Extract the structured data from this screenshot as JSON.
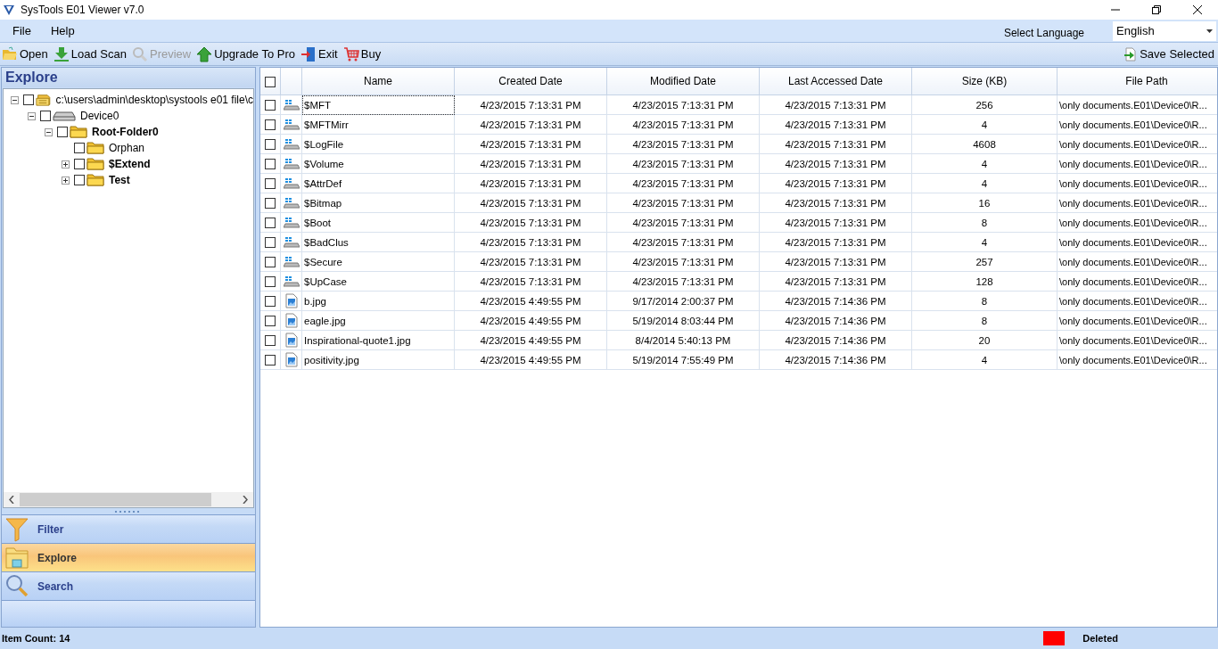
{
  "window": {
    "title": "SysTools E01 Viewer v7.0"
  },
  "menu": [
    "File",
    "Help"
  ],
  "language": {
    "label": "Select Language",
    "value": "English"
  },
  "toolbar": [
    {
      "kind": "open",
      "label": "Open",
      "disabled": false
    },
    {
      "kind": "load",
      "label": "Load Scan",
      "disabled": false
    },
    {
      "kind": "preview",
      "label": "Preview",
      "disabled": true
    },
    {
      "kind": "upgrade",
      "label": "Upgrade To Pro",
      "disabled": false
    },
    {
      "kind": "exit",
      "label": "Exit",
      "disabled": false
    },
    {
      "kind": "buy",
      "label": "Buy",
      "disabled": false
    }
  ],
  "save_button": "Save Selected",
  "explore": {
    "title": "Explore",
    "tree": [
      {
        "kind": "volume",
        "label": "c:\\users\\admin\\desktop\\systools e01 file\\c",
        "checked": false,
        "bold": false,
        "expanded": true,
        "children": [
          {
            "kind": "device",
            "label": "Device0",
            "checked": false,
            "bold": false,
            "expanded": true,
            "children": [
              {
                "kind": "folder",
                "label": "Root-Folder0",
                "checked": false,
                "bold": true,
                "expanded": true,
                "children": [
                  {
                    "kind": "folder",
                    "label": "Orphan",
                    "checked": false,
                    "bold": false
                  },
                  {
                    "kind": "folder",
                    "label": "$Extend",
                    "checked": false,
                    "bold": true,
                    "expanded": false
                  },
                  {
                    "kind": "folder",
                    "label": "Test",
                    "checked": false,
                    "bold": true,
                    "expanded": false
                  }
                ]
              }
            ]
          }
        ]
      }
    ]
  },
  "nav": [
    {
      "kind": "filter",
      "label": "Filter",
      "selected": false
    },
    {
      "kind": "explore",
      "label": "Explore",
      "selected": true
    },
    {
      "kind": "search",
      "label": "Search",
      "selected": false
    }
  ],
  "table": {
    "all_checked": false,
    "columns": [
      "Name",
      "Created Date",
      "Modified Date",
      "Last Accessed Date",
      "Size (KB)",
      "File Path"
    ],
    "rows": [
      {
        "kind": "system",
        "checked": false,
        "cells": [
          "$MFT",
          "4/23/2015 7:13:31 PM",
          "4/23/2015 7:13:31 PM",
          "4/23/2015 7:13:31 PM",
          "256",
          "\\only documents.E01\\Device0\\R..."
        ]
      },
      {
        "kind": "system",
        "checked": false,
        "cells": [
          "$MFTMirr",
          "4/23/2015 7:13:31 PM",
          "4/23/2015 7:13:31 PM",
          "4/23/2015 7:13:31 PM",
          "4",
          "\\only documents.E01\\Device0\\R..."
        ]
      },
      {
        "kind": "system",
        "checked": false,
        "cells": [
          "$LogFile",
          "4/23/2015 7:13:31 PM",
          "4/23/2015 7:13:31 PM",
          "4/23/2015 7:13:31 PM",
          "4608",
          "\\only documents.E01\\Device0\\R..."
        ]
      },
      {
        "kind": "system",
        "checked": false,
        "cells": [
          "$Volume",
          "4/23/2015 7:13:31 PM",
          "4/23/2015 7:13:31 PM",
          "4/23/2015 7:13:31 PM",
          "4",
          "\\only documents.E01\\Device0\\R..."
        ]
      },
      {
        "kind": "system",
        "checked": false,
        "cells": [
          "$AttrDef",
          "4/23/2015 7:13:31 PM",
          "4/23/2015 7:13:31 PM",
          "4/23/2015 7:13:31 PM",
          "4",
          "\\only documents.E01\\Device0\\R..."
        ]
      },
      {
        "kind": "system",
        "checked": false,
        "cells": [
          "$Bitmap",
          "4/23/2015 7:13:31 PM",
          "4/23/2015 7:13:31 PM",
          "4/23/2015 7:13:31 PM",
          "16",
          "\\only documents.E01\\Device0\\R..."
        ]
      },
      {
        "kind": "system",
        "checked": false,
        "cells": [
          "$Boot",
          "4/23/2015 7:13:31 PM",
          "4/23/2015 7:13:31 PM",
          "4/23/2015 7:13:31 PM",
          "8",
          "\\only documents.E01\\Device0\\R..."
        ]
      },
      {
        "kind": "system",
        "checked": false,
        "cells": [
          "$BadClus",
          "4/23/2015 7:13:31 PM",
          "4/23/2015 7:13:31 PM",
          "4/23/2015 7:13:31 PM",
          "4",
          "\\only documents.E01\\Device0\\R..."
        ]
      },
      {
        "kind": "system",
        "checked": false,
        "cells": [
          "$Secure",
          "4/23/2015 7:13:31 PM",
          "4/23/2015 7:13:31 PM",
          "4/23/2015 7:13:31 PM",
          "257",
          "\\only documents.E01\\Device0\\R..."
        ]
      },
      {
        "kind": "system",
        "checked": false,
        "cells": [
          "$UpCase",
          "4/23/2015 7:13:31 PM",
          "4/23/2015 7:13:31 PM",
          "4/23/2015 7:13:31 PM",
          "128",
          "\\only documents.E01\\Device0\\R..."
        ]
      },
      {
        "kind": "image",
        "checked": false,
        "cells": [
          "b.jpg",
          "4/23/2015 4:49:55 PM",
          "9/17/2014 2:00:37 PM",
          "4/23/2015 7:14:36 PM",
          "8",
          "\\only documents.E01\\Device0\\R..."
        ]
      },
      {
        "kind": "image",
        "checked": false,
        "cells": [
          "eagle.jpg",
          "4/23/2015 4:49:55 PM",
          "5/19/2014 8:03:44 PM",
          "4/23/2015 7:14:36 PM",
          "8",
          "\\only documents.E01\\Device0\\R..."
        ]
      },
      {
        "kind": "image",
        "checked": false,
        "cells": [
          "Inspirational-quote1.jpg",
          "4/23/2015 4:49:55 PM",
          "8/4/2014 5:40:13 PM",
          "4/23/2015 7:14:36 PM",
          "20",
          "\\only documents.E01\\Device0\\R..."
        ]
      },
      {
        "kind": "image",
        "checked": false,
        "cells": [
          "positivity.jpg",
          "4/23/2015 4:49:55 PM",
          "5/19/2014 7:55:49 PM",
          "4/23/2015 7:14:36 PM",
          "4",
          "\\only documents.E01\\Device0\\R..."
        ]
      }
    ]
  },
  "status_bar": {
    "item_count": "Item Count: 14",
    "legend": [
      {
        "label": "Deleted",
        "color": "#ff0000"
      }
    ]
  }
}
